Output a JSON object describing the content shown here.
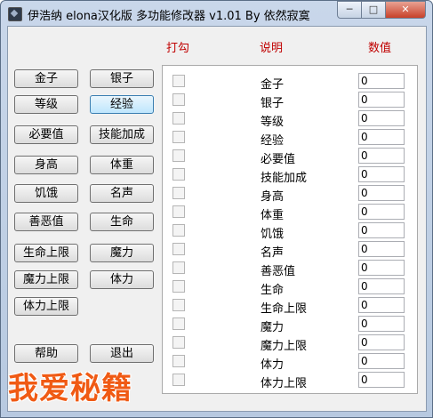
{
  "window": {
    "title": "伊浩纳 elona汉化版 多功能修改器 v1.01 By 依然寂寞",
    "min_label": "─",
    "max_label": "□",
    "close_label": "✕"
  },
  "headers": {
    "check": "打勾",
    "desc": "说明",
    "value": "数值"
  },
  "buttons": [
    "金子",
    "银子",
    "等级",
    "经验",
    "必要值",
    "技能加成",
    "身高",
    "体重",
    "饥饿",
    "名声",
    "善恶值",
    "生命",
    "生命上限",
    "魔力",
    "魔力上限",
    "体力",
    "体力上限",
    "帮助",
    "退出"
  ],
  "active_button": "经验",
  "rows": [
    {
      "label": "金子",
      "value": "0"
    },
    {
      "label": "银子",
      "value": "0"
    },
    {
      "label": "等级",
      "value": "0"
    },
    {
      "label": "经验",
      "value": "0"
    },
    {
      "label": "必要值",
      "value": "0"
    },
    {
      "label": "技能加成",
      "value": "0"
    },
    {
      "label": "身高",
      "value": "0"
    },
    {
      "label": "体重",
      "value": "0"
    },
    {
      "label": "饥饿",
      "value": "0"
    },
    {
      "label": "名声",
      "value": "0"
    },
    {
      "label": "善恶值",
      "value": "0"
    },
    {
      "label": "生命",
      "value": "0"
    },
    {
      "label": "生命上限",
      "value": "0"
    },
    {
      "label": "魔力",
      "value": "0"
    },
    {
      "label": "魔力上限",
      "value": "0"
    },
    {
      "label": "体力",
      "value": "0"
    },
    {
      "label": "体力上限",
      "value": "0"
    }
  ],
  "watermark": "我爱秘籍",
  "colors": {
    "header": "#c00000",
    "watermark": "#f05a14"
  }
}
